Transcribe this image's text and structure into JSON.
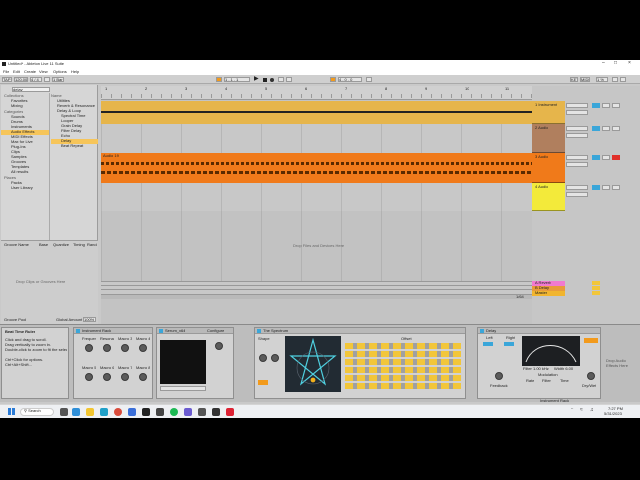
{
  "window": {
    "title": "Untitled* - Ableton Live 11 Suite",
    "menu": [
      "File",
      "Edit",
      "Create",
      "View",
      "Options",
      "Help"
    ]
  },
  "transport": {
    "tempo": "120.00",
    "signature": "4 / 4",
    "bar_position": "1 . 1 . 1",
    "loop_length": "4 . 0 . 0",
    "cpu": "1 %"
  },
  "browser": {
    "search_placeholder": "delay",
    "collections_header": "Collections",
    "collections": [
      "Favorites",
      "Mixing"
    ],
    "categories_header": "Categories",
    "categories": [
      "Sounds",
      "Drums",
      "Instruments",
      "Audio Effects",
      "MIDI Effects",
      "Max for Live",
      "Plug-Ins",
      "Clips",
      "Samples",
      "Grooves",
      "Templates",
      "All results"
    ],
    "places_header": "Places",
    "places": [
      "Packs",
      "User Library"
    ],
    "name_header": "Name",
    "results": [
      "Utilities",
      "Reverb & Resonance",
      "Delay & Loop",
      "Spectral Time",
      "Looper",
      "Grain Delay",
      "Filter Delay",
      "Echo",
      "Delay",
      "Beat Repeat"
    ],
    "selected_result": "Delay"
  },
  "groove_pool": {
    "columns": [
      "Groove Name",
      "Base",
      "Quantize",
      "Timing",
      "Rando"
    ],
    "empty_text": "Drop Clips or Grooves Here",
    "footer_left": "Groove Pool",
    "footer_right": "Global Amount",
    "global_amount": "100%"
  },
  "arrangement": {
    "ruler_marks": [
      "1",
      "2",
      "3",
      "4",
      "5",
      "6",
      "7",
      "8",
      "9",
      "10",
      "11"
    ],
    "drop_text": "Drop Files and Devices Here",
    "tracks": [
      {
        "name": "1 Instrument",
        "color": "#e9b44a"
      },
      {
        "name": "2 Audio",
        "color": "#b07f5e"
      },
      {
        "name": "3 Audio",
        "color": "#f07a1a"
      },
      {
        "name": "4 Audio",
        "color": "#f3ea3a"
      }
    ],
    "return_tracks": [
      {
        "name": "A Reverb",
        "color": "#f07ad0"
      },
      {
        "name": "B Delay",
        "color": "#e89b3a"
      },
      {
        "name": "Master",
        "color": "#f1b52f"
      }
    ],
    "clip_label": "Audio 19",
    "zoom_indicator": "1/64"
  },
  "devices": {
    "info_title": "Beat Time Ruler",
    "info_lines": [
      "Click and drag to scroll.",
      "Drag vertically to zoom in.",
      "Double-click to zoom to fit the selection.",
      "Ctrl+Click for options.",
      "Ctrl+Alt+Shift..."
    ],
    "instrument_rack": {
      "title": "Instrument Rack",
      "macros": [
        "Frequency",
        "Resonance",
        "Macro 3",
        "Macro 4",
        "Macro 5",
        "Macro 6",
        "Macro 7",
        "Macro 8"
      ]
    },
    "serum": {
      "title": "Serum_x64",
      "config": "Configure"
    },
    "spectrum": {
      "title": "The Spectrum",
      "params": [
        "Shape",
        "Rate",
        "Amount",
        "Offset"
      ]
    },
    "delay": {
      "title": "Delay",
      "labels": [
        "Left",
        "Right",
        "Sync",
        "Feedback",
        "Dry/Wet",
        "Filter",
        "Modulation",
        "Rate",
        "Filter",
        "Time"
      ],
      "filter_readout": "Filter 1.00 kHz",
      "width_readout": "Width 6.00"
    },
    "drop_text": "Drop Audio Effects Here",
    "status_label": "Instrument Rack"
  },
  "taskbar": {
    "search_label": "Search",
    "time": "7:27 PM",
    "date": "5/31/2023"
  },
  "colors": {
    "accent_orange": "#f29a1c",
    "track_yellow": "#e9b44a",
    "track_orange": "#f07a1a",
    "clip_yellow": "#f3ea3a"
  }
}
